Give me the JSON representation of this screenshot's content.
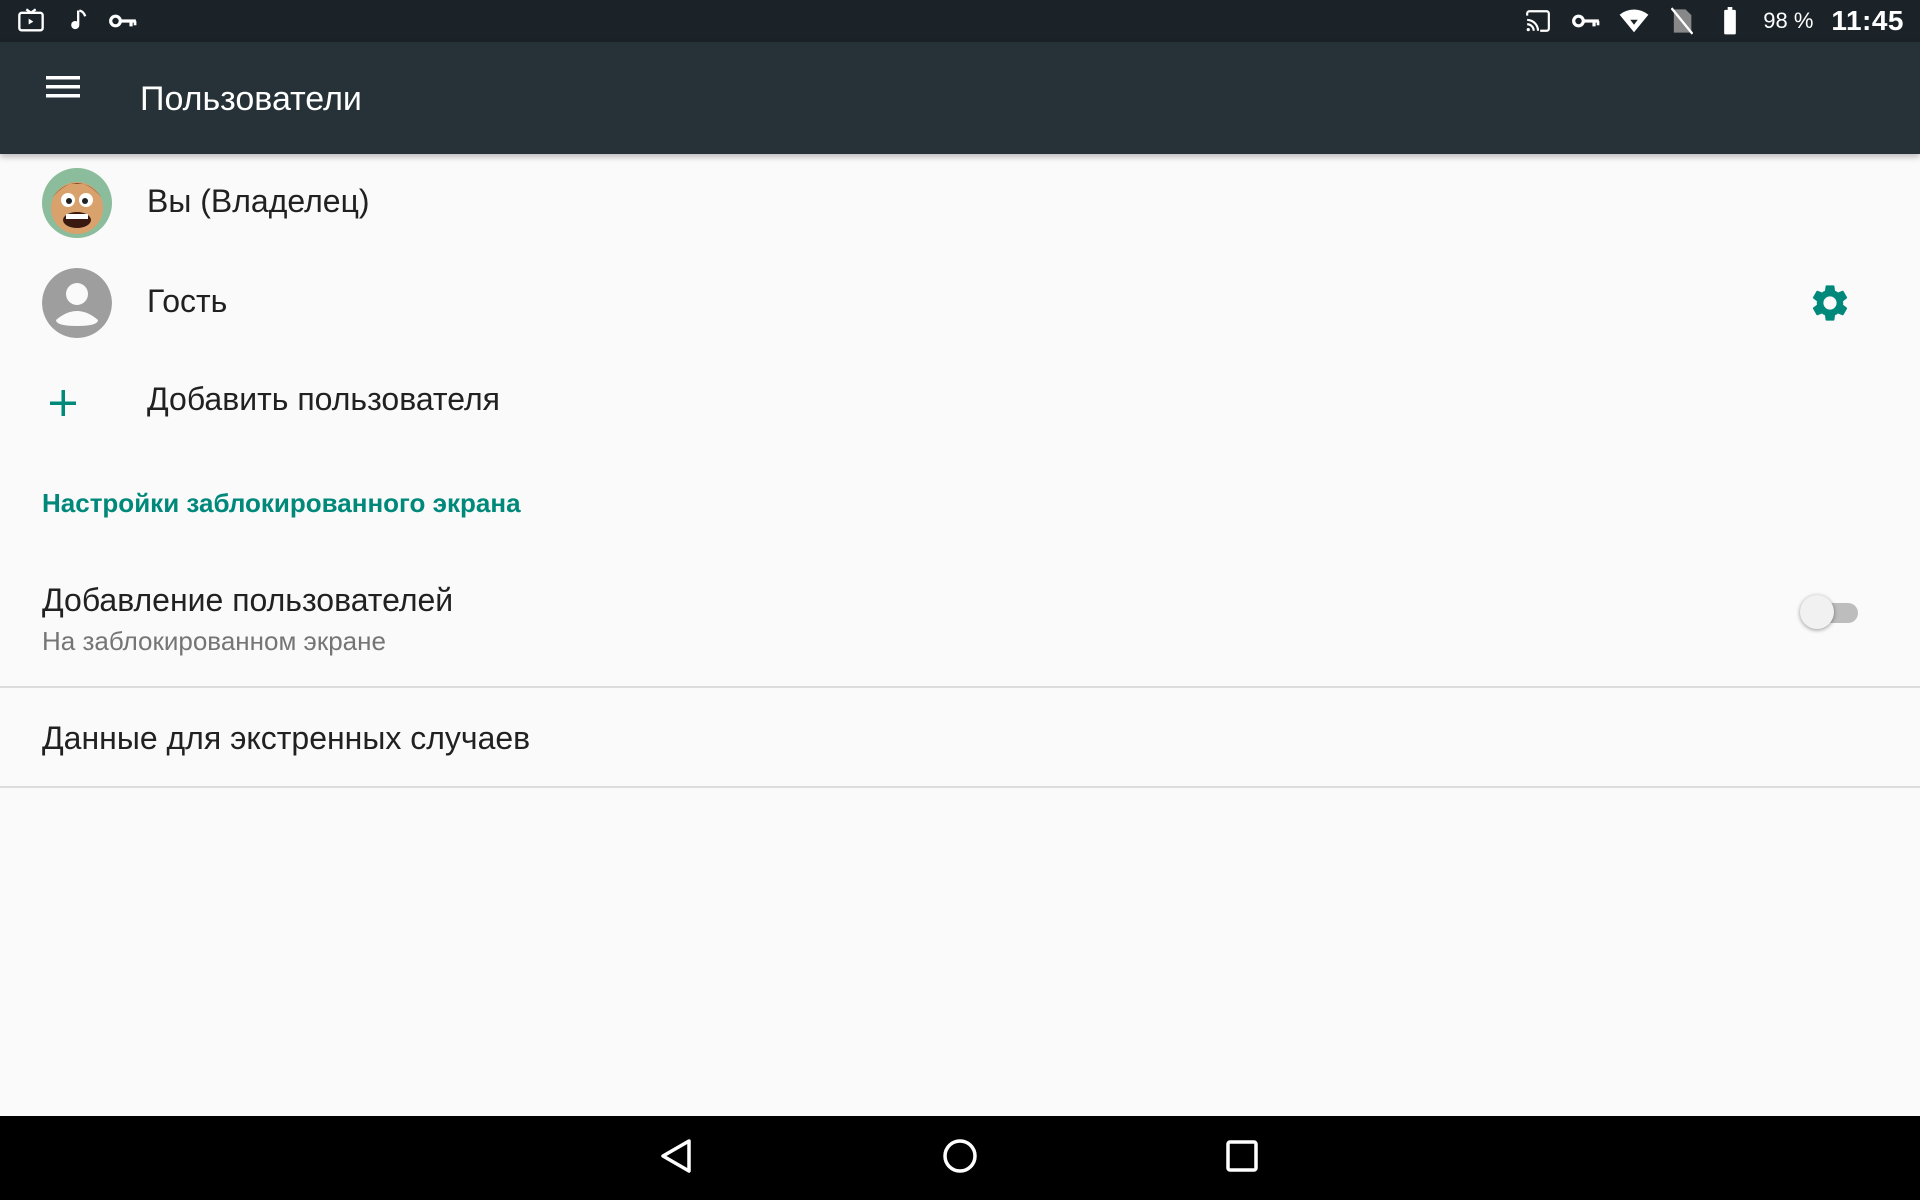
{
  "status_bar": {
    "left_icons": [
      "tv-notification-icon",
      "music-note-icon",
      "vpn-key-icon"
    ],
    "right_icons": [
      "cast-icon",
      "vpn-key-icon",
      "wifi-icon",
      "no-sim-icon",
      "battery-icon"
    ],
    "battery": "98 %",
    "time": "11:45"
  },
  "app_bar": {
    "title": "Пользователи",
    "menu_icon": "hamburger-menu-icon"
  },
  "users": [
    {
      "label": "Вы (Владелец)",
      "avatar": "owner-avatar"
    },
    {
      "label": "Гость",
      "avatar": "guest-avatar",
      "action_icon": "gear-icon"
    }
  ],
  "add_user": {
    "label": "Добавить пользователя",
    "icon": "plus-icon"
  },
  "lock_screen_section": {
    "header": "Настройки заблокированного экрана",
    "add_users_setting": {
      "title": "Добавление пользователей",
      "subtitle": "На заблокированном экране",
      "enabled": false
    }
  },
  "emergency": {
    "label": "Данные для экстренных случаев"
  },
  "nav_bar": {
    "buttons": [
      "back-icon",
      "home-icon",
      "recents-icon"
    ]
  },
  "colors": {
    "accent": "#00897b",
    "app_bar": "#263238",
    "status_bar": "#1b2328"
  }
}
